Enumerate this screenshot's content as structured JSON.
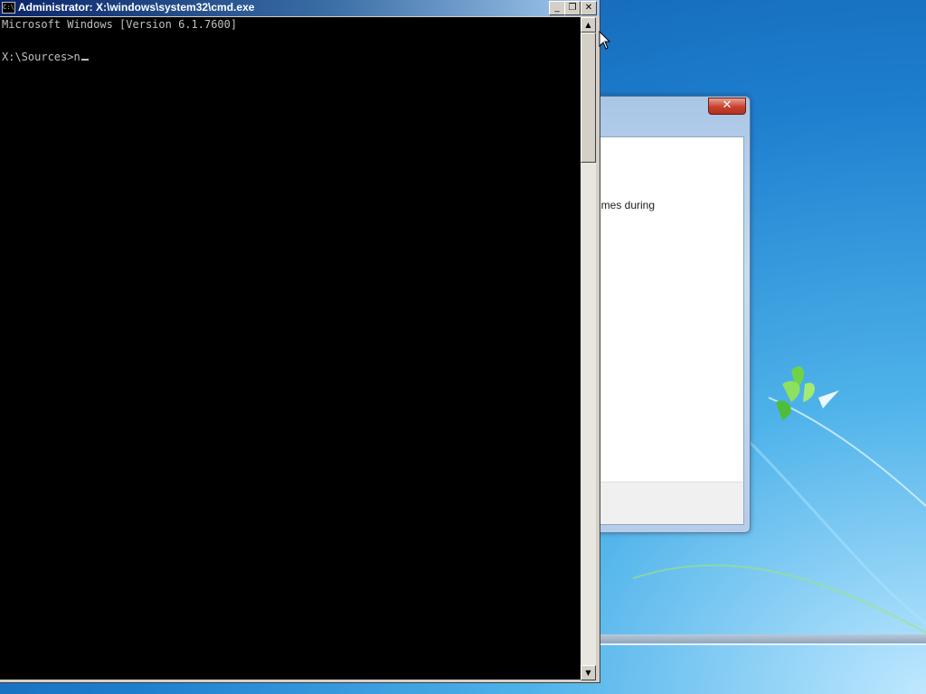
{
  "cmd_window": {
    "title": "Administrator: X:\\windows\\system32\\cmd.exe",
    "icon_label": "C:\\",
    "buttons": {
      "minimize": "_",
      "restore": "❐",
      "close": "✕"
    },
    "console_lines": [
      "Microsoft Windows [Version 6.1.7600]",
      "",
      "X:\\Sources>n"
    ],
    "scroll_up": "▲",
    "scroll_down": "▼"
  },
  "background_window": {
    "close_label": "✕",
    "partial_text": "imes during"
  },
  "colors": {
    "console_bg": "#000000",
    "console_text": "#c0c0c0",
    "titlebar_start": "#0a246a",
    "titlebar_end": "#a6caf0"
  }
}
